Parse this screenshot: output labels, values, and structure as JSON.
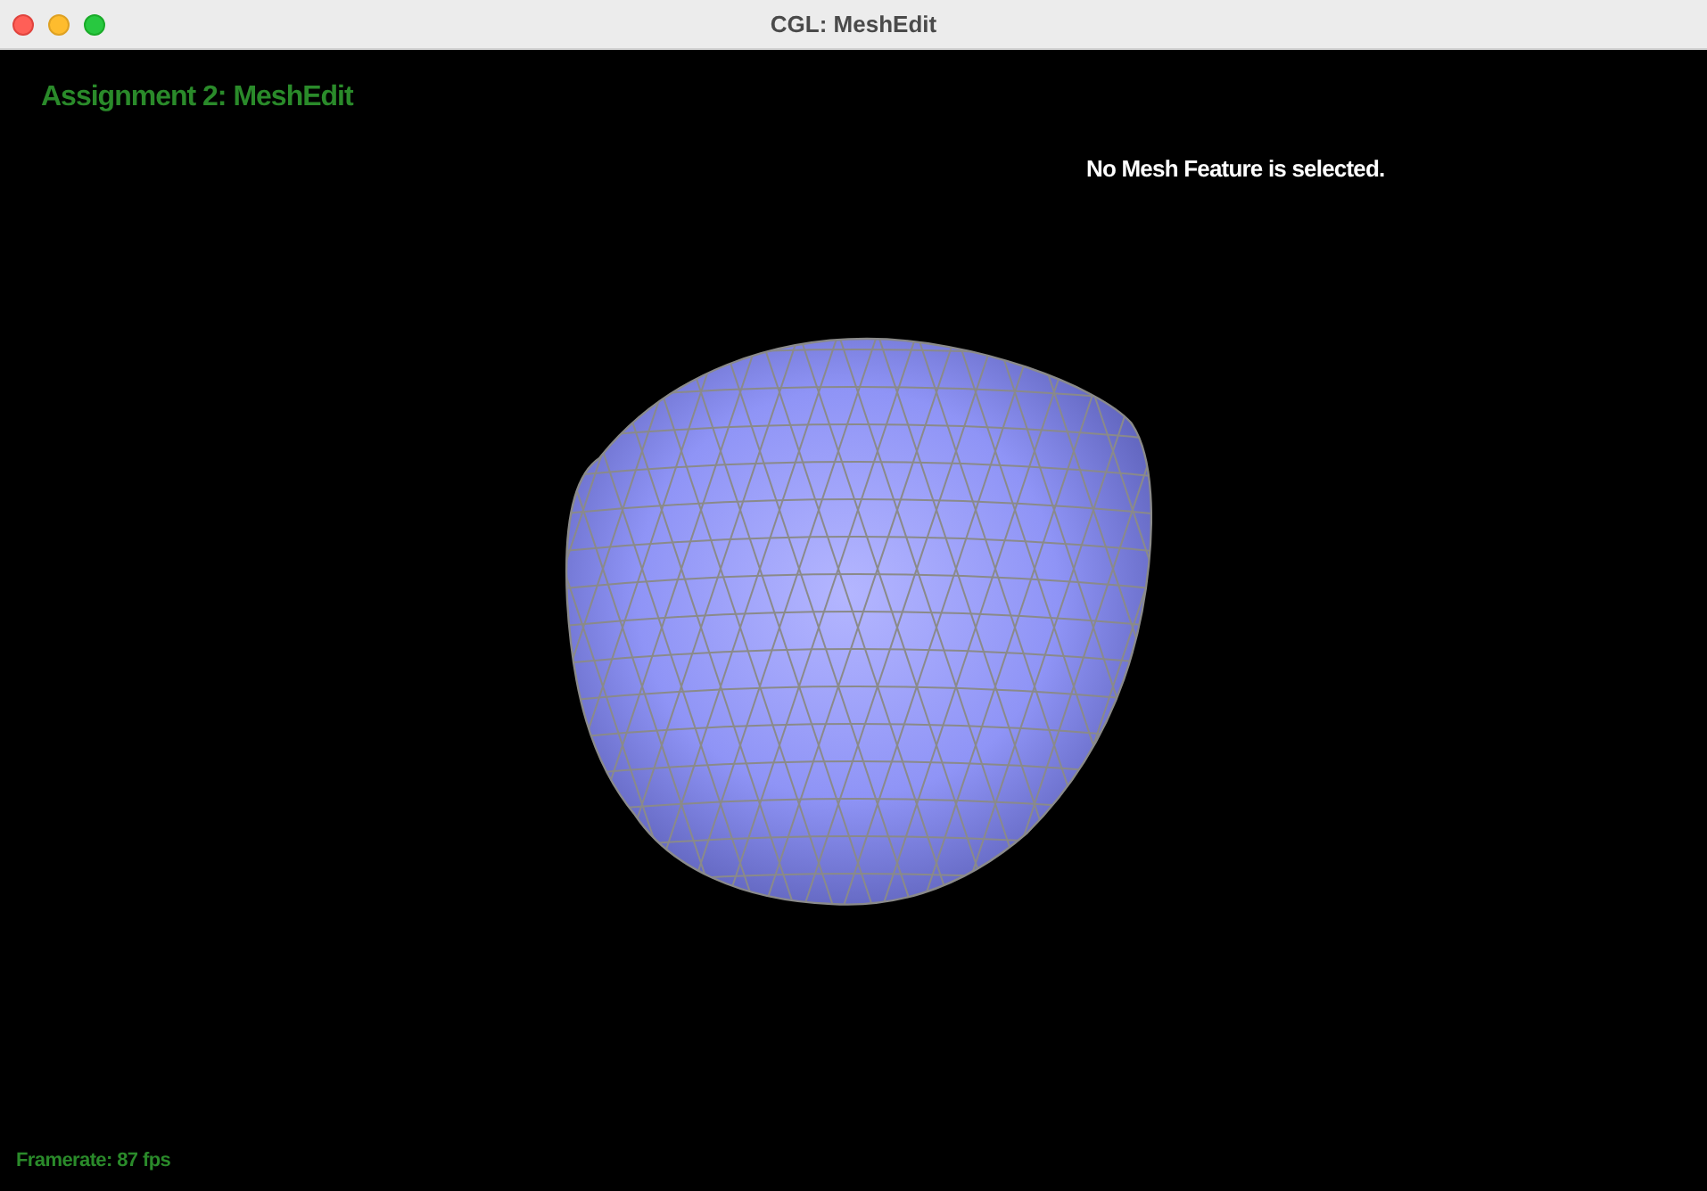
{
  "window": {
    "title": "CGL: MeshEdit"
  },
  "viewport": {
    "heading": "Assignment 2: MeshEdit",
    "selection_message": "No Mesh Feature is selected.",
    "framerate": "Framerate: 87 fps"
  }
}
